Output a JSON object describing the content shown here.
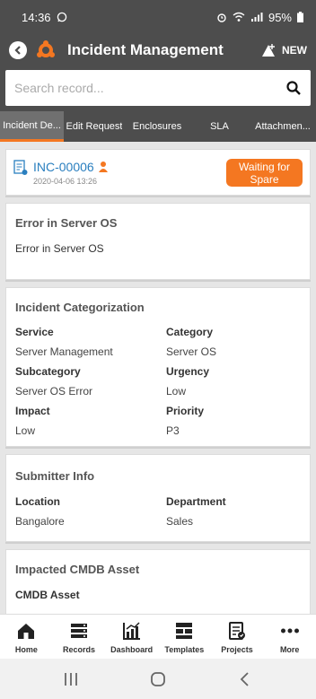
{
  "status_bar": {
    "time": "14:36",
    "battery": "95%"
  },
  "header": {
    "title": "Incident Management",
    "new_label": "NEW"
  },
  "search": {
    "placeholder": "Search record..."
  },
  "tabs": [
    {
      "label": "Incident De..."
    },
    {
      "label": "Edit Request"
    },
    {
      "label": "Enclosures"
    },
    {
      "label": "SLA"
    },
    {
      "label": "Attachmen..."
    }
  ],
  "incident": {
    "id": "INC-00006",
    "date": "2020-04-06 13:26",
    "status_label": "Waiting for Spare"
  },
  "title_section": {
    "title": "Error in Server OS",
    "description": "Error in Server OS"
  },
  "categorization": {
    "title": "Incident Categorization",
    "fields": [
      {
        "label": "Service",
        "value": "Server Management"
      },
      {
        "label": "Category",
        "value": "Server OS"
      },
      {
        "label": "Subcategory",
        "value": "Server OS Error"
      },
      {
        "label": "Urgency",
        "value": "Low"
      },
      {
        "label": "Impact",
        "value": "Low"
      },
      {
        "label": "Priority",
        "value": "P3"
      }
    ]
  },
  "submitter": {
    "title": "Submitter Info",
    "fields": [
      {
        "label": "Location",
        "value": "Bangalore"
      },
      {
        "label": "Department",
        "value": "Sales"
      }
    ]
  },
  "cmdb": {
    "title": "Impacted CMDB Asset",
    "field_label": "CMDB Asset",
    "field_value": "--"
  },
  "bottom_nav": [
    {
      "label": "Home",
      "icon": "home-icon"
    },
    {
      "label": "Records",
      "icon": "records-icon"
    },
    {
      "label": "Dashboard",
      "icon": "dashboard-icon"
    },
    {
      "label": "Templates",
      "icon": "templates-icon"
    },
    {
      "label": "Projects",
      "icon": "projects-icon"
    },
    {
      "label": "More",
      "icon": "more-icon"
    }
  ],
  "colors": {
    "accent": "#f47721",
    "header": "#4d4d4d",
    "link": "#2a7fbf"
  }
}
